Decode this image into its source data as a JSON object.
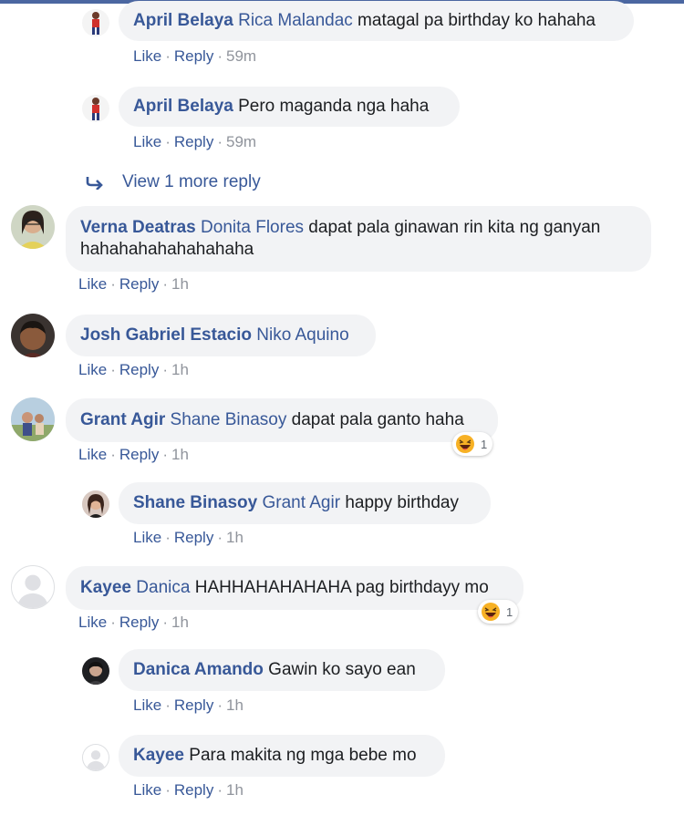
{
  "comments": [
    {
      "author": "April Belaya",
      "mention": "Rica Malandac",
      "text": " matagal pa birthday ko hahaha",
      "time": "59m"
    },
    {
      "author": "April Belaya",
      "mention": "",
      "text": " Pero maganda nga haha",
      "time": "59m"
    },
    {
      "author": "Verna Deatras",
      "mention": "Donita Flores",
      "text": " dapat pala ginawan rin kita ng ganyan hahahahahahahahaha",
      "time": "1h"
    },
    {
      "author": "Josh Gabriel Estacio",
      "mention": "Niko Aquino",
      "text": "",
      "time": "1h"
    },
    {
      "author": "Grant Agir",
      "mention": "Shane Binasoy",
      "text": " dapat pala ganto haha",
      "time": "1h",
      "reactions": "1"
    },
    {
      "author": "Shane Binasoy",
      "mention": "Grant Agir",
      "text": " happy birthday",
      "time": "1h"
    },
    {
      "author": "Kayee",
      "mention": "Danica",
      "text": " HAHHAHAHAHAHA pag birthdayy mo",
      "time": "1h",
      "reactions": "1"
    },
    {
      "author": "Danica Amando",
      "mention": "",
      "text": " Gawin ko sayo ean",
      "time": "1h"
    },
    {
      "author": "Kayee",
      "mention": "",
      "text": " Para makita ng mga bebe mo",
      "time": "1h"
    }
  ],
  "actions": {
    "like": "Like",
    "reply": "Reply",
    "sep": "·"
  },
  "view_more": "View 1 more reply",
  "colors": {
    "link": "#385898",
    "bubble": "#f2f3f5",
    "meta_gray": "#90949c"
  }
}
